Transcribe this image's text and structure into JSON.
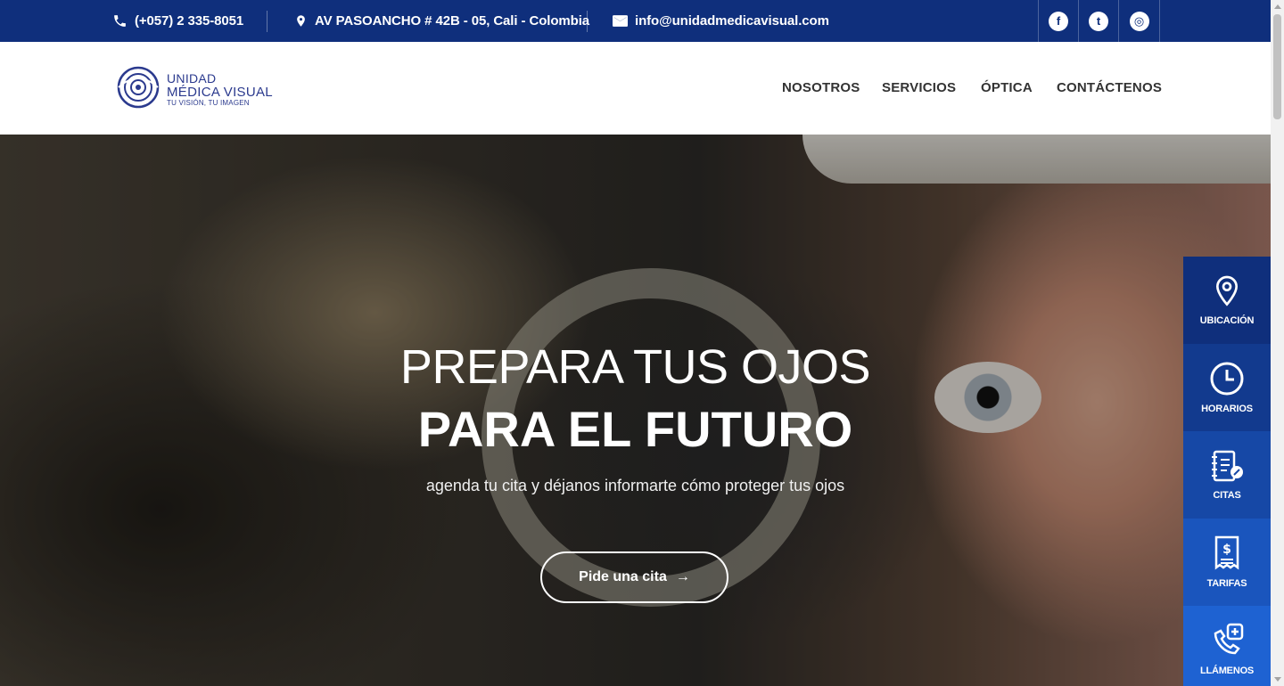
{
  "topbar": {
    "phone": "(+057) 2 335-8051",
    "address": "AV PASOANCHO # 42B - 05, Cali - Colombia",
    "email": "info@unidadmedicavisual.com",
    "social": [
      {
        "name": "facebook-icon",
        "glyph": "f"
      },
      {
        "name": "twitter-icon",
        "glyph": "t"
      },
      {
        "name": "instagram-icon",
        "glyph": "◎"
      }
    ],
    "bg_color": "#0f2f7c"
  },
  "logo": {
    "line1": "UNIDAD",
    "line2": "MÉDICA VISUAL",
    "tagline": "TU VISIÓN, TU IMAGEN"
  },
  "nav": {
    "items": [
      "NOSOTROS",
      "SERVICIOS",
      "ÓPTICA",
      "CONTÁCTENOS"
    ]
  },
  "hero": {
    "title_line1": "PREPARA TUS OJOS",
    "title_line2": "PARA EL FUTURO",
    "subtitle": "agenda tu cita y déjanos informarte cómo proteger tus ojos",
    "cta_label": "Pide una cita",
    "cta_arrow": "→"
  },
  "side_widget": {
    "items": [
      {
        "label": "UBICACIÓN",
        "icon": "location-pin-icon",
        "color": "#0f2f7c"
      },
      {
        "label": "HORARIOS",
        "icon": "clock-icon",
        "color": "#123a8e"
      },
      {
        "label": "CITAS",
        "icon": "appointment-book-icon",
        "color": "#1648a6"
      },
      {
        "label": "TARIFAS",
        "icon": "price-receipt-icon",
        "color": "#1a55bd"
      },
      {
        "label": "LLÁMENOS",
        "icon": "phone-plus-icon",
        "color": "#1e62d2"
      }
    ]
  }
}
